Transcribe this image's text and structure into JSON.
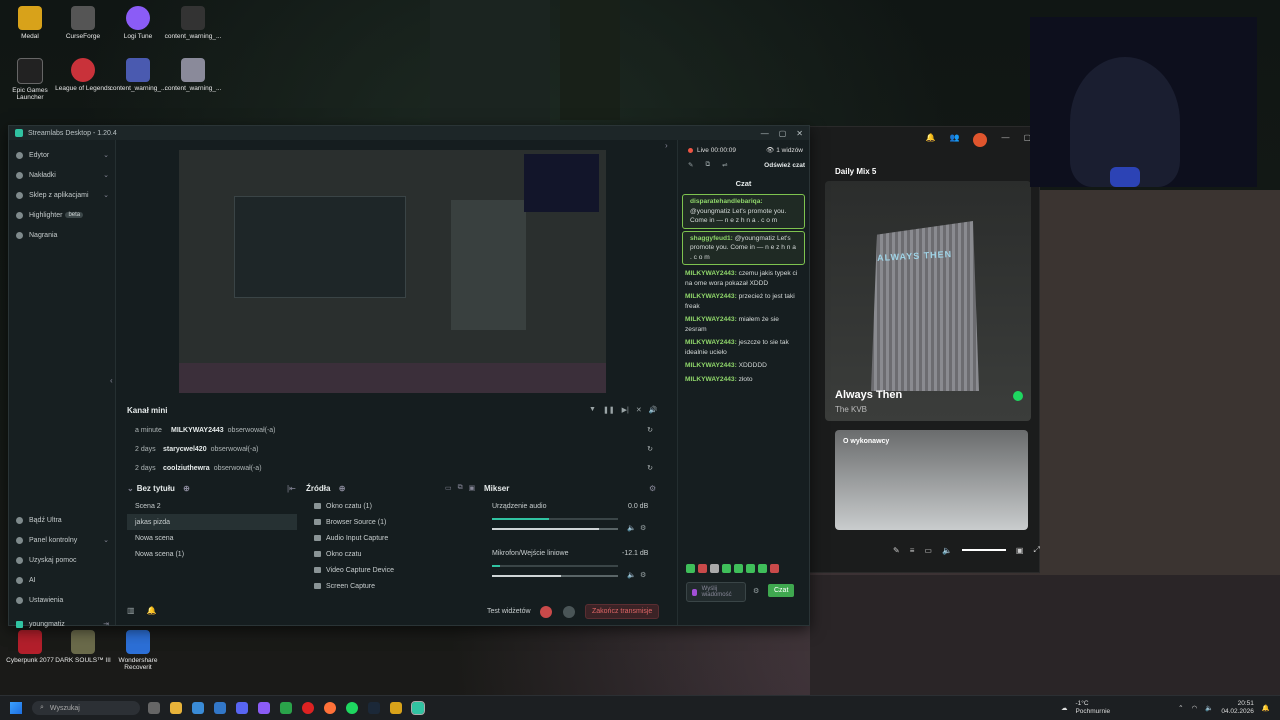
{
  "desktop": {
    "icons": [
      {
        "label": "Medal",
        "color": "#d8a21a"
      },
      {
        "label": "CurseForge",
        "color": "#444"
      },
      {
        "label": "Logi Tune",
        "color": "#8b5cf6"
      },
      {
        "label": "content_warning_...",
        "color": "#333"
      },
      {
        "label": "Epic Games Launcher",
        "color": "#222"
      },
      {
        "label": "League of Legends",
        "color": "#c9323a"
      },
      {
        "label": "content_warning_...",
        "color": "#4a5ab0"
      },
      {
        "label": "content_warning_...",
        "color": "#8a8a9a"
      },
      {
        "label": "Cyberpunk 2077",
        "color": "#b31f2b"
      },
      {
        "label": "DARK SOULS™ III",
        "color": "#6a6a4a"
      },
      {
        "label": "Wondershare Recoverit",
        "color": "#2c6fd6"
      }
    ]
  },
  "streamlabs": {
    "title": "Streamlabs Desktop - 1.20.4",
    "sidebar": {
      "items": [
        {
          "label": "Edytor",
          "chevron": true
        },
        {
          "label": "Nakładki",
          "chevron": true
        },
        {
          "label": "Sklep z aplikacjami",
          "chevron": true
        },
        {
          "label": "Highlighter",
          "badge": "beta"
        },
        {
          "label": "Nagrania"
        }
      ],
      "bottom": [
        {
          "label": "Bądź Ultra"
        },
        {
          "label": "Panel kontrolny",
          "chevron": true
        },
        {
          "label": "Uzyskaj pomoc"
        },
        {
          "label": "AI"
        },
        {
          "label": "Ustawienia"
        }
      ],
      "user": "youngmatiz"
    },
    "mini_feed": {
      "title": "Kanał mini",
      "rows": [
        {
          "time": "a minute",
          "user": "MILKYWAY2443",
          "action": "obserwował(-a)"
        },
        {
          "time": "2 days",
          "user": "starycwel420",
          "action": "obserwował(-a)"
        },
        {
          "time": "2 days",
          "user": "coolziuthewra",
          "action": "obserwował(-a)"
        }
      ]
    },
    "scenes": {
      "title": "Bez tytułu",
      "items": [
        "Scena 2",
        "jakas pizda",
        "Nowa scena",
        "Nowa scena (1)"
      ],
      "selected": 1
    },
    "sources": {
      "title": "Źródła",
      "items": [
        "Okno czatu (1)",
        "Browser Source (1)",
        "Audio Input Capture",
        "Okno czatu",
        "Video Capture Device",
        "Screen Capture"
      ]
    },
    "mixer": {
      "title": "Mikser",
      "channels": [
        {
          "name": "Urządzenie audio",
          "db": "0.0 dB",
          "level": 0.45,
          "volume": 0.85
        },
        {
          "name": "Mikrofon/Wejście liniowe",
          "db": "-12.1 dB",
          "level": 0.06,
          "volume": 0.55
        }
      ]
    },
    "footer": {
      "test": "Test widżetów",
      "end": "Zakończ transmisje"
    },
    "chat": {
      "live": "Live 00:00:09",
      "viewers": "1 widzów",
      "refresh": "Odśwież czat",
      "title": "Czat",
      "messages": [
        {
          "user": "disparatehandlebariqa:",
          "text": "@youngmatiz Let's promote you. Come in — n e z h n a . c o m",
          "highlight": true
        },
        {
          "user": "shaggyfeud1:",
          "text": "@youngmatiz Let's promote you. Come in — n e z h n a . c o m",
          "highlight": true
        },
        {
          "user": "MILKYWAY2443:",
          "text": "czemu jakis typek ci na ome wora pokazał XDDD"
        },
        {
          "user": "MILKYWAY2443:",
          "text": "przecież to jest taki freak"
        },
        {
          "user": "MILKYWAY2443:",
          "text": "miałem że sie zesram"
        },
        {
          "user": "MILKYWAY2443:",
          "text": "jeszcze to sie tak idealnie uciełо"
        },
        {
          "user": "MILKYWAY2443:",
          "text": "XDDDDD"
        },
        {
          "user": "MILKYWAY2443:",
          "text": "złoto"
        }
      ],
      "input_placeholder": "Wyślij wiadomość",
      "send": "Czat"
    }
  },
  "spotify": {
    "playlist": "Daily Mix 5",
    "track": "Always Then",
    "artist": "The KVB",
    "about": "O wykonawcy",
    "sign": "ALWAYS THEN"
  },
  "taskbar": {
    "search": "Wyszukaj",
    "weather_temp": "-1°C",
    "weather_desc": "Pochmurnie",
    "time": "20:51",
    "date": "04.02.2026"
  }
}
